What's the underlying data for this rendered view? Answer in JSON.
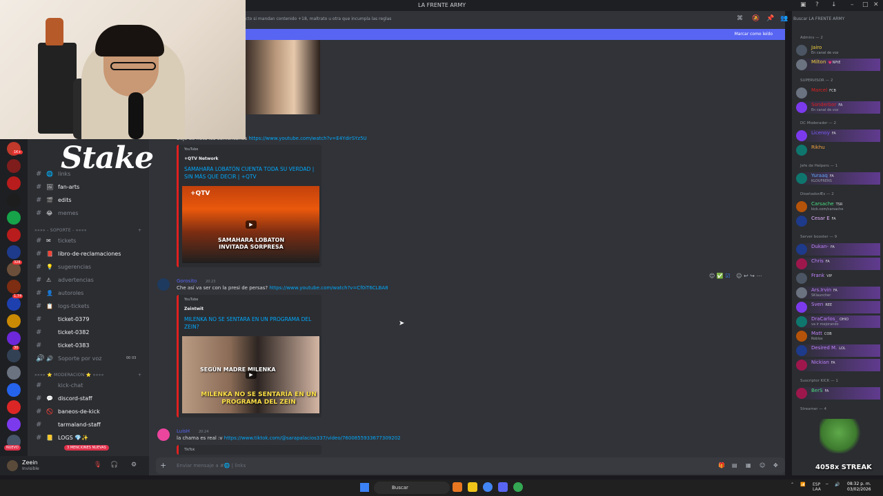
{
  "window": {
    "title": "LA FRENTE ARMY"
  },
  "webcam": {
    "overlay_logo": "Stake"
  },
  "servers": [
    {
      "color": "#c0392b"
    },
    {
      "color": "#7f1d1d"
    },
    {
      "color": "#b91c1c"
    },
    {
      "color": "#1d1d1d"
    },
    {
      "color": "#16a34a"
    },
    {
      "color": "#b91c1c"
    },
    {
      "color": "#1e3a8a"
    },
    {
      "color": "#6b4f3a"
    },
    {
      "color": "#7c2d12"
    },
    {
      "color": "#1e40af"
    },
    {
      "color": "#ca8a04"
    },
    {
      "color": "#6d28d9"
    },
    {
      "color": "#334155"
    },
    {
      "color": "#6b7280"
    },
    {
      "color": "#2563eb"
    },
    {
      "color": "#dc2626"
    },
    {
      "color": "#7c3aed"
    },
    {
      "color": "#475569"
    }
  ],
  "server_badges": [
    "1K+",
    "328",
    "1,74",
    "30"
  ],
  "channels": {
    "top": [
      {
        "name": "links",
        "icon": "🌐"
      },
      {
        "name": "fan-arts",
        "icon": "🖼"
      },
      {
        "name": "edits",
        "icon": "🎬"
      },
      {
        "name": "memes",
        "icon": "😂"
      }
    ],
    "category_soporte": "»»»» - SOPORTE - ««««",
    "soporte": [
      {
        "name": "tickets",
        "icon": "✉"
      },
      {
        "name": "libro-de-reclamaciones",
        "icon": "📕"
      },
      {
        "name": "sugerencias",
        "icon": "💡"
      },
      {
        "name": "advertencias",
        "icon": "⚠"
      },
      {
        "name": "autoroles",
        "icon": "👤"
      },
      {
        "name": "logs-tickets",
        "icon": "📋"
      },
      {
        "name": "ticket-0379",
        "icon": ""
      },
      {
        "name": "ticket-0382",
        "icon": ""
      },
      {
        "name": "ticket-0383",
        "icon": ""
      },
      {
        "name": "Soporte por voz",
        "icon": "🔊",
        "extra": "00  03"
      }
    ],
    "category_moderacion": "»»»» ⭐ MODERACION ⭐ ««««",
    "moderacion": [
      {
        "name": "kick-chat",
        "icon": ""
      },
      {
        "name": "discord-staff",
        "icon": "💬"
      },
      {
        "name": "baneos-de-kick",
        "icon": "🚫"
      },
      {
        "name": "tarmaland-staff",
        "icon": ""
      },
      {
        "name": "LOGS 💎✨",
        "icon": "📒"
      }
    ]
  },
  "nuevo_badge": "NUEVO",
  "mentions_badge": "3 MENCIONES NUEVAS",
  "user": {
    "name": "Zeein",
    "status": "Invisible"
  },
  "channel_topic": "cto si mandan contenido +18, maltrato u otra que incumpla las reglas",
  "new_messages_bar": {
    "label": "Marcar como leído"
  },
  "messages": [
    {
      "partial_text": "Baje de nota los comentarios",
      "link": "https://www.youtube.com/watch?v=E4YdirSYz5U",
      "embed": {
        "provider": "YouTube",
        "author": "+QTV Network",
        "title": "SAMAHARA LOBATÓN CUENTA TODA SU VERDAD | SIN MÁS QUE DECIR | +QTV",
        "thumb_caption": "SAMAHARA LOBATON INVITADA SORPRESA",
        "thumb_logo": "+QTV"
      }
    },
    {
      "author": "Gorosito",
      "time": "20:23",
      "text": "Che así va ser con la presi de persas?",
      "link": "https://www.youtube.com/watch?v=Cf0iT6CLBA8",
      "embed": {
        "provider": "YouTube",
        "author": "Zeintwit",
        "title": "MILENKA NO SE SENTARA EN UN PROGRAMA DEL ZEIN?",
        "thumb_caption_1": "SEGÚN MADRE MILENKA",
        "thumb_caption_2": "MILENKA NO SE SENTARÍA EN UN PROGRAMA DEL ZEIN"
      }
    },
    {
      "author": "LuisH",
      "time": "20:24",
      "text": "la chama es real :v",
      "link": "https://www.tiktok.com/@sarapalacios337/video/7600855933677309202",
      "embed": {
        "provider": "TikTok"
      }
    }
  ],
  "composer": {
    "placeholder": "Enviar mensaje a #🌐 | links"
  },
  "members": {
    "search_placeholder": "Buscar LA FRENTE ARMY",
    "groups": [
      {
        "label": "Admins — 2",
        "members": [
          {
            "name": "Jairo",
            "color": "#f4d03f",
            "sub": "En canal de voz",
            "badge": ""
          },
          {
            "name": "Milton",
            "color": "#f4d03f",
            "sub": "",
            "badge": "💗NPtE",
            "hl": true
          }
        ]
      },
      {
        "label": "SUPERVISOR — 2",
        "members": [
          {
            "name": "Marcel",
            "color": "#e02020",
            "sub": "",
            "badge": "FCB"
          },
          {
            "name": "Sonderbor",
            "color": "#e02020",
            "sub": "En canal de voz",
            "badge": "FA",
            "hl": true
          }
        ]
      },
      {
        "label": "DC Moderador — 2",
        "members": [
          {
            "name": "Licenoy",
            "color": "#7c5cff",
            "sub": "",
            "badge": "FA",
            "hl": true
          },
          {
            "name": "Rikhu",
            "color": "#f4a340",
            "sub": "",
            "badge": ""
          }
        ]
      },
      {
        "label": "Jefe de Helpers — 1",
        "members": [
          {
            "name": "Yuraaq",
            "color": "#60a5fa",
            "sub": "KLOUFRENS",
            "badge": "FA",
            "hl": true
          }
        ]
      },
      {
        "label": "DiseñadorÆs — 2",
        "members": [
          {
            "name": "Carsache",
            "color": "#4ade80",
            "sub": "kick.com/carsache",
            "badge": "TSR"
          },
          {
            "name": "Cesar E",
            "color": "#e5b0ff",
            "sub": "",
            "badge": "FA"
          }
        ]
      },
      {
        "label": "Server booster — 9",
        "members": [
          {
            "name": "Dukan-",
            "color": "#c084fc",
            "sub": "",
            "badge": "FA",
            "hl": true
          },
          {
            "name": "Chris",
            "color": "#c084fc",
            "sub": "",
            "badge": "FA",
            "hl": true
          },
          {
            "name": "Frank",
            "color": "#c084fc",
            "sub": "",
            "badge": "VIP"
          },
          {
            "name": "Ars.Irvin",
            "color": "#c084fc",
            "sub": "SKlauncher",
            "badge": "FA",
            "hl": true
          },
          {
            "name": "Sven",
            "color": "#c084fc",
            "sub": "",
            "badge": "REE",
            "hl": true
          },
          {
            "name": "DraCarlos_",
            "color": "#c084fc",
            "sub": "va ir mejorando",
            "badge": "OHIO",
            "hl": true
          },
          {
            "name": "Matt",
            "color": "#c084fc",
            "sub": "Roblox",
            "badge": "COB"
          },
          {
            "name": "Desired M.",
            "color": "#c084fc",
            "sub": "",
            "badge": "LOL",
            "hl": true
          },
          {
            "name": "Nickian",
            "color": "#c084fc",
            "sub": "",
            "badge": "FA",
            "hl": true
          }
        ]
      },
      {
        "label": "Suscriptor KICK — 1",
        "members": [
          {
            "name": "BerS",
            "color": "#4ade80",
            "sub": "",
            "badge": "FA",
            "hl": true
          }
        ]
      },
      {
        "label": "Streamer — 4",
        "members": []
      }
    ]
  },
  "overlay_streak": "4058x STREAK",
  "taskbar": {
    "search": "Buscar",
    "lang": "ESP\nLAA",
    "time": "08:32 p. m.",
    "date": "03/02/2026"
  }
}
